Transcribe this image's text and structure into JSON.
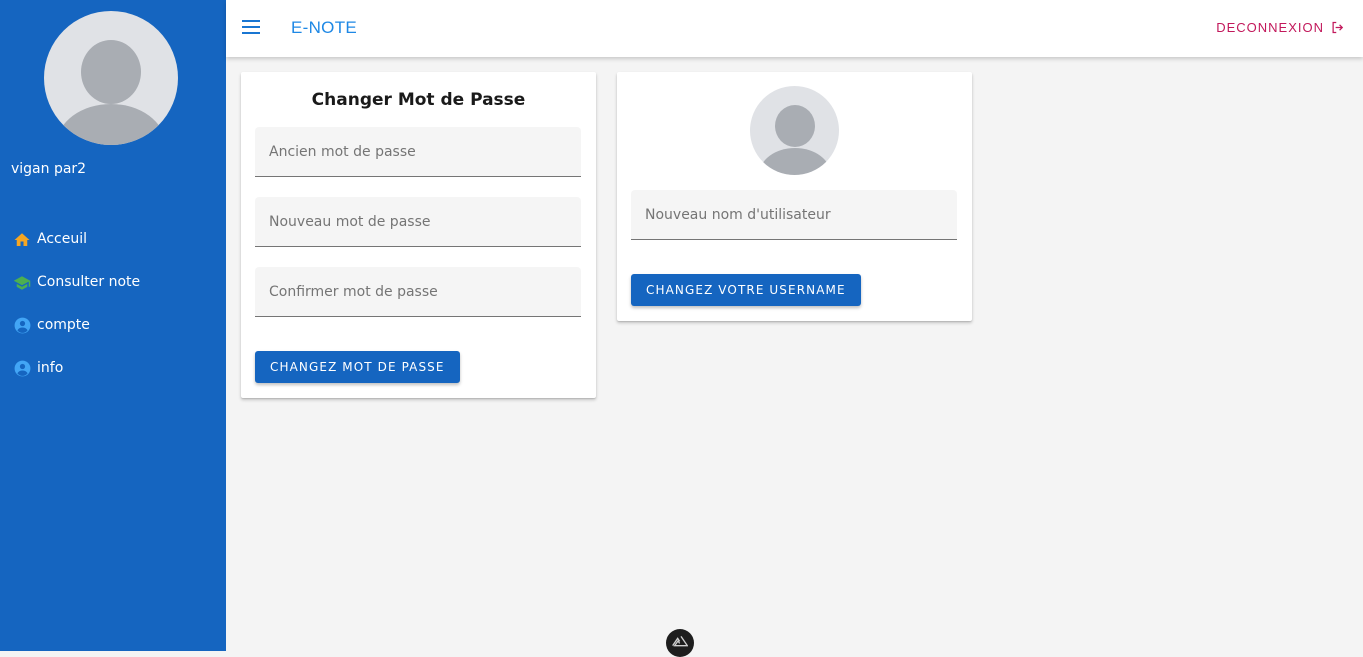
{
  "sidebar": {
    "username": "vigan par2",
    "items": [
      {
        "label": "Acceuil",
        "icon": "home-icon",
        "color": "#f59e0b"
      },
      {
        "label": "Consulter note",
        "icon": "graduation-cap-icon",
        "color": "#4caf50"
      },
      {
        "label": "compte",
        "icon": "account-circle-icon",
        "color": "#42a5f5"
      },
      {
        "label": "info",
        "icon": "account-circle-icon",
        "color": "#42a5f5"
      }
    ]
  },
  "header": {
    "title": "E-NOTE",
    "logout_label": "DECONNEXION"
  },
  "password_card": {
    "title": "Changer Mot de Passe",
    "old_password_placeholder": "Ancien mot de passe",
    "new_password_placeholder": "Nouveau mot de passe",
    "confirm_password_placeholder": "Confirmer mot de passe",
    "submit_label": "CHANGEZ MOT DE PASSE"
  },
  "username_card": {
    "new_username_placeholder": "Nouveau nom d'utilisateur",
    "submit_label": "CHANGEZ VOTRE USERNAME"
  },
  "colors": {
    "sidebar_bg": "#1565c0",
    "accent": "#1976d2",
    "logout": "#c2185b"
  }
}
